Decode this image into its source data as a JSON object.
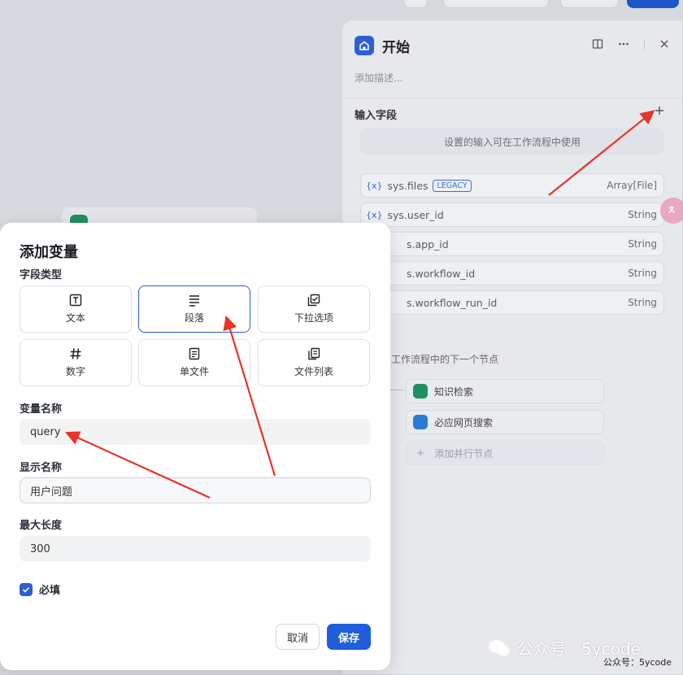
{
  "panel": {
    "title": "开始",
    "description": "添加描述...",
    "input_section_title": "输入字段",
    "empty_hint": "设置的输入可在工作流程中使用",
    "variables": [
      {
        "name": "sys.files",
        "badge": "LEGACY",
        "type": "Array[File]"
      },
      {
        "name": "sys.user_id",
        "type": "String"
      },
      {
        "name": "s.app_id",
        "type": "String"
      },
      {
        "name": "s.workflow_id",
        "type": "String"
      },
      {
        "name": "s.workflow_run_id",
        "type": "String"
      }
    ],
    "next_step_title": "工作流程中的下一个节点",
    "next_nodes": [
      {
        "label": "知识检索"
      },
      {
        "label": "必应网页搜索"
      },
      {
        "label": "添加并行节点"
      }
    ]
  },
  "modal": {
    "title": "添加变量",
    "field_type_label": "字段类型",
    "types": [
      {
        "label": "文本",
        "icon": "text-icon"
      },
      {
        "label": "段落",
        "icon": "paragraph-icon",
        "selected": true
      },
      {
        "label": "下拉选项",
        "icon": "select-icon"
      },
      {
        "label": "数字",
        "icon": "number-icon"
      },
      {
        "label": "单文件",
        "icon": "file-icon"
      },
      {
        "label": "文件列表",
        "icon": "file-list-icon"
      }
    ],
    "var_name_label": "变量名称",
    "var_name_value": "query",
    "display_name_label": "显示名称",
    "display_name_value": "用户问题",
    "max_length_label": "最大长度",
    "max_length_value": "300",
    "required_label": "必填",
    "required_checked": true,
    "cancel_label": "取消",
    "save_label": "保存"
  },
  "watermark": {
    "main": "公众号 · 5ycode",
    "small": "公众号：5ycode"
  },
  "colors": {
    "accent": "#1f5ed8",
    "arrow": "#e8352a"
  }
}
